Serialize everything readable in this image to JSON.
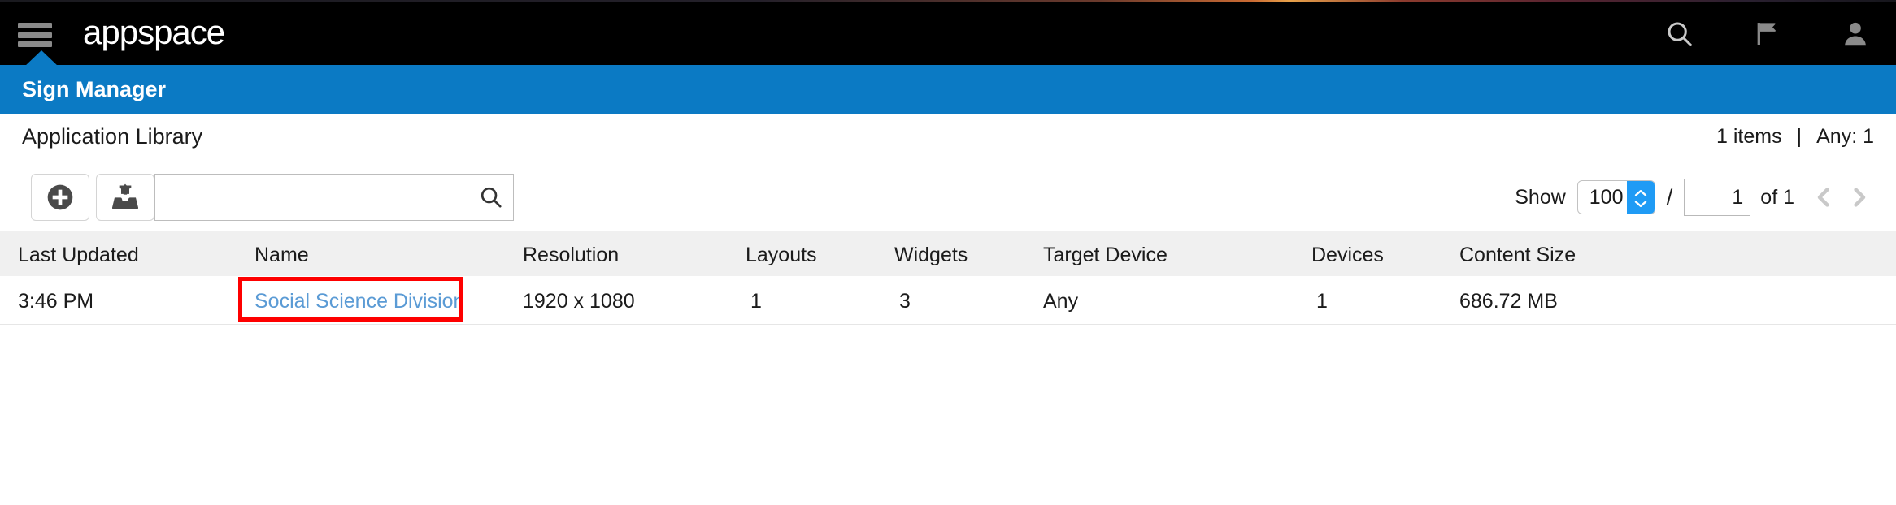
{
  "topbar": {
    "menu_icon": "hamburger-menu-icon",
    "brand": "appspace",
    "icons": [
      {
        "name": "search-icon",
        "label": "Search"
      },
      {
        "name": "flag-icon",
        "label": "Flag"
      },
      {
        "name": "user-account-icon",
        "label": "Account"
      }
    ]
  },
  "section": {
    "title": "Sign Manager",
    "accent_color": "#0b7ac4"
  },
  "library": {
    "title": "Application Library",
    "items_count": "1 items",
    "separator": "|",
    "any_count": "Any: 1"
  },
  "toolbar": {
    "add_button_label": "add-icon",
    "upload_button_label": "upload-tray-icon",
    "search_value": "",
    "search_placeholder": "",
    "search_icon": "search-icon"
  },
  "pager": {
    "show_label": "Show",
    "page_size": "100",
    "page_size_options": [
      "100"
    ],
    "slash": "/",
    "current_page": "1",
    "of_label": "of 1",
    "prev_icon": "chevron-left-icon",
    "next_icon": "chevron-right-icon",
    "stepper_up_icon": "chevron-up-icon",
    "stepper_down_icon": "chevron-down-icon",
    "stepper_color": "#1f9bf5"
  },
  "table": {
    "columns": [
      "Last Updated",
      "Name",
      "Resolution",
      "Layouts",
      "Widgets",
      "Target Device",
      "Devices",
      "Content Size"
    ],
    "rows": [
      {
        "last_updated": "3:46 PM",
        "name": "Social Science Division",
        "resolution": "1920 x 1080",
        "layouts": "1",
        "widgets": "3",
        "target_device": "Any",
        "devices": "1",
        "content_size": "686.72 MB"
      }
    ],
    "link_color": "#5b9bd5",
    "header_bg": "#f0f0f0"
  },
  "annotation": {
    "color": "#fe0000",
    "target": "Social Science Division"
  }
}
